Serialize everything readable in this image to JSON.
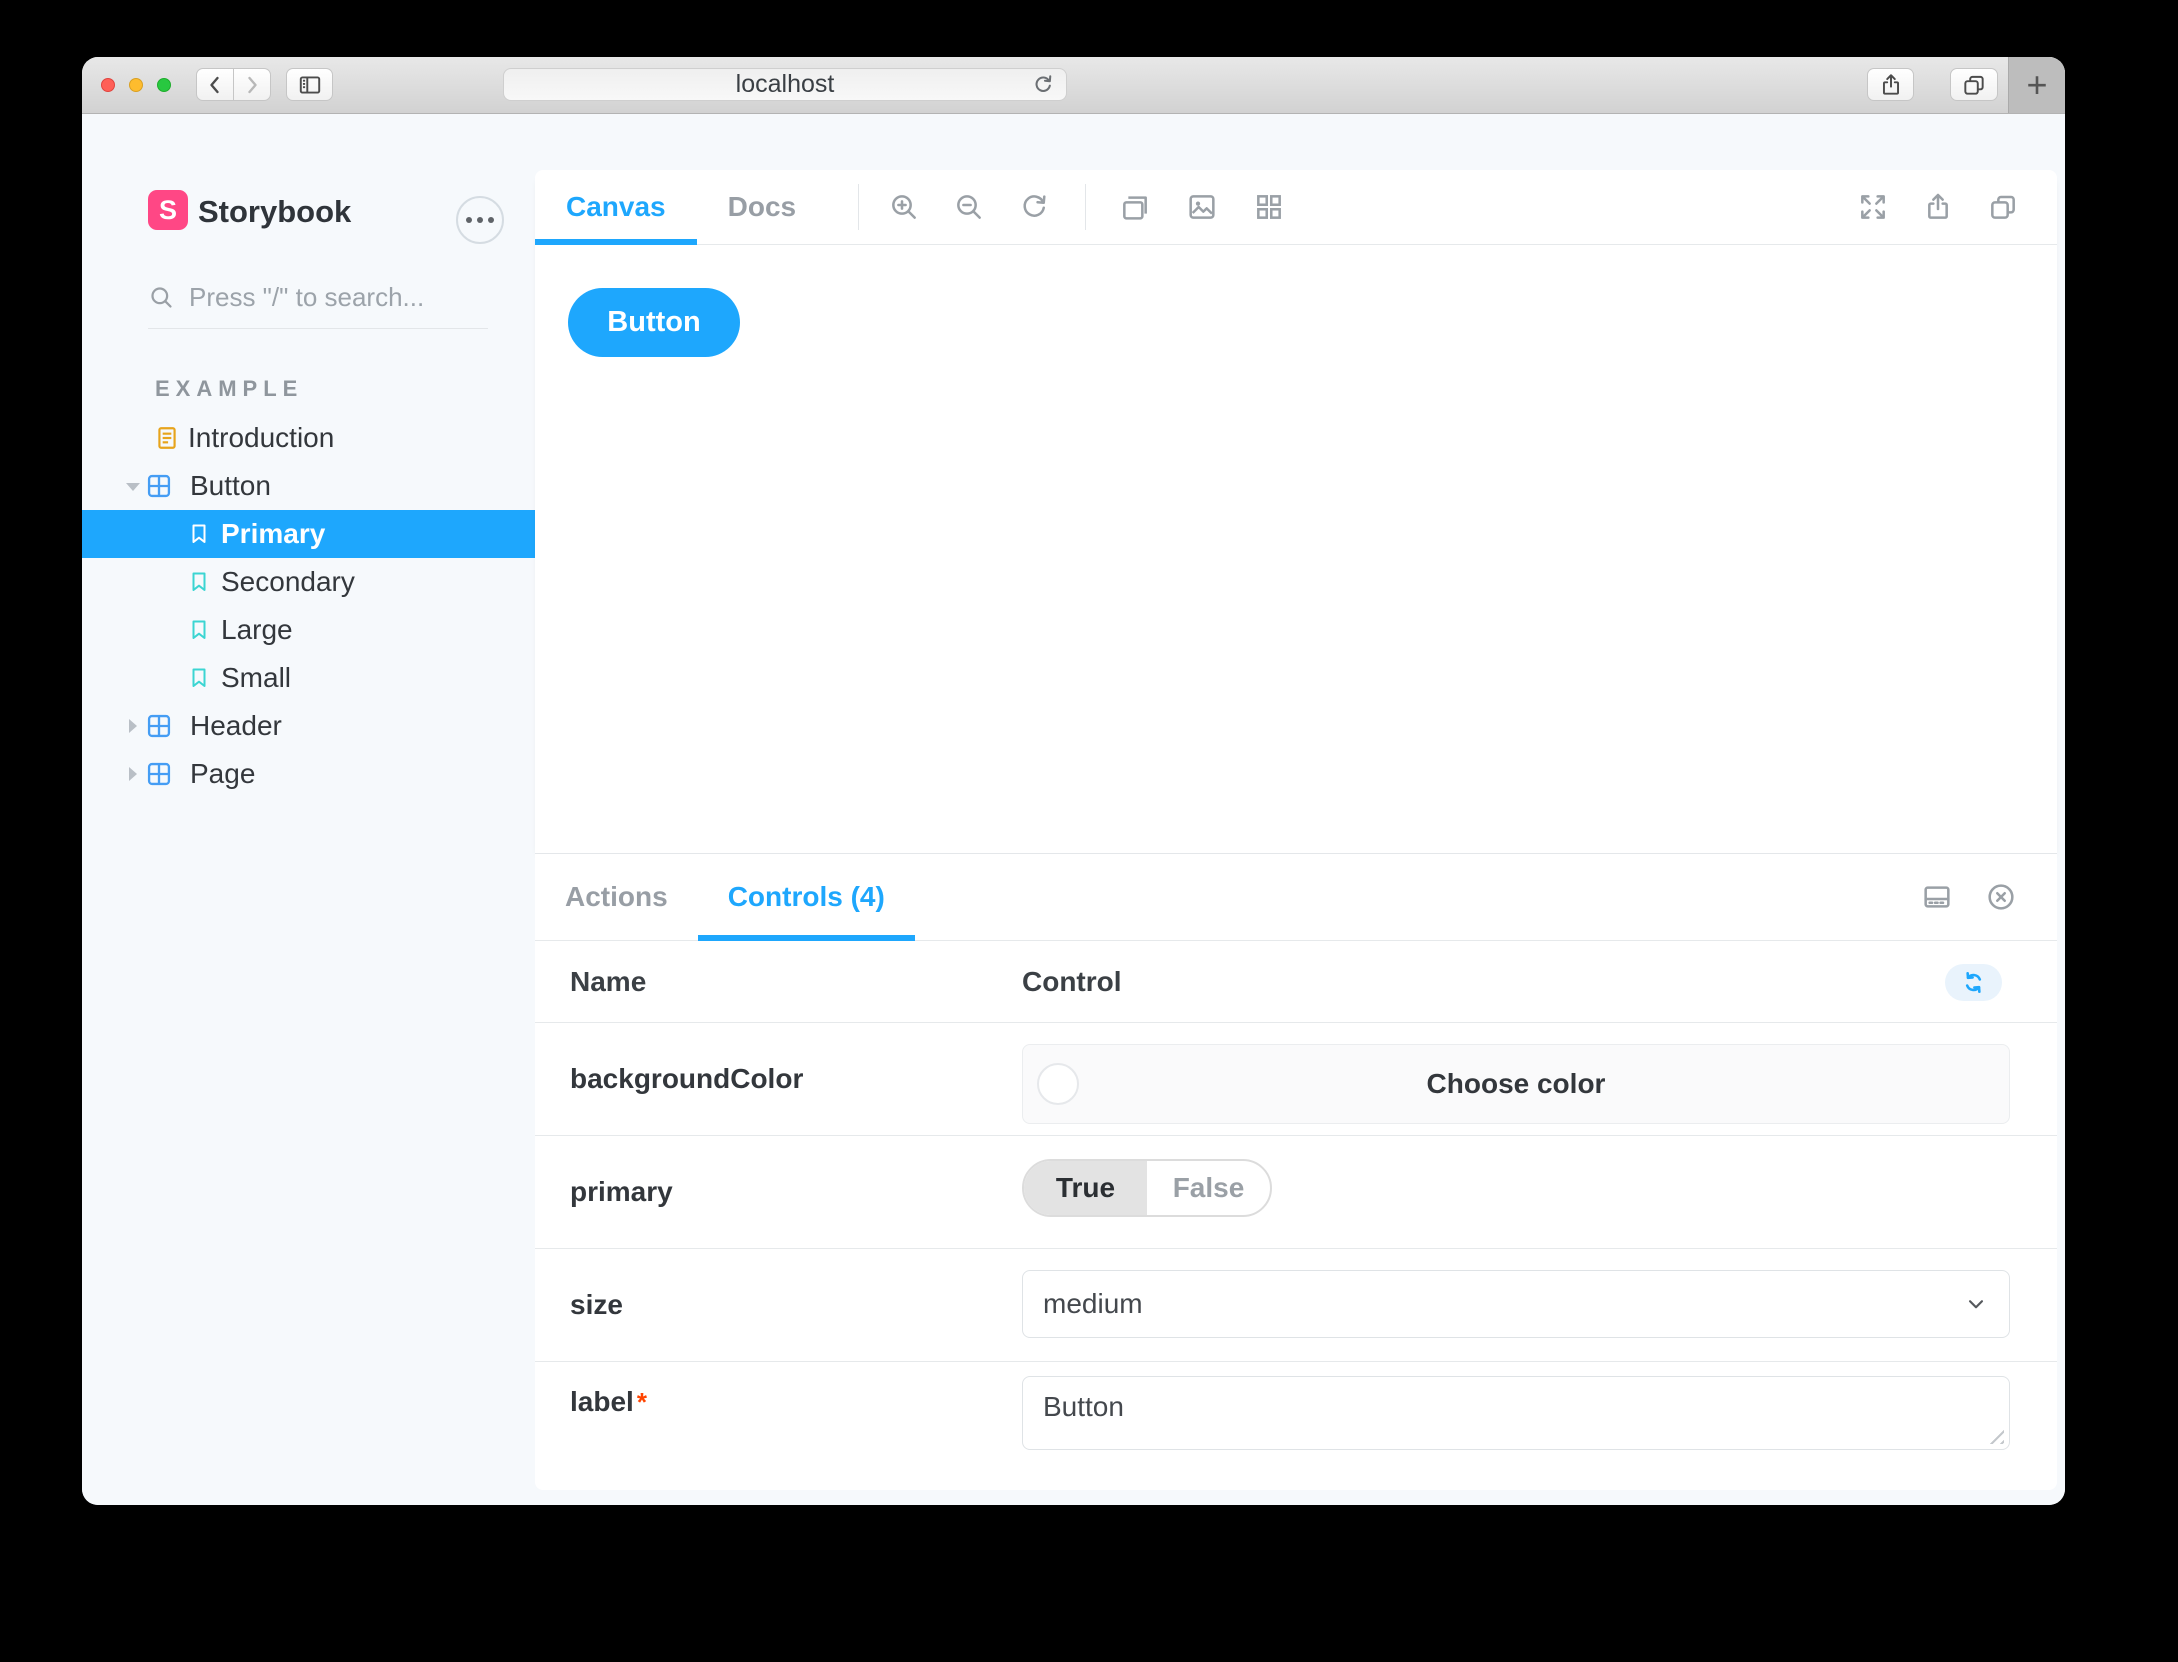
{
  "browser": {
    "url": "localhost",
    "new_tab_label": "+"
  },
  "sidebar": {
    "brand": "Storybook",
    "logo_letter": "S",
    "search_placeholder": "Press \"/\" to search...",
    "section_title": "EXAMPLE",
    "items": [
      {
        "label": "Introduction",
        "type": "doc"
      },
      {
        "label": "Button",
        "type": "component",
        "state": "expanded"
      },
      {
        "label": "Primary",
        "type": "story",
        "state": "selected"
      },
      {
        "label": "Secondary",
        "type": "story"
      },
      {
        "label": "Large",
        "type": "story"
      },
      {
        "label": "Small",
        "type": "story"
      },
      {
        "label": "Header",
        "type": "component",
        "state": "collapsed"
      },
      {
        "label": "Page",
        "type": "component",
        "state": "collapsed"
      }
    ]
  },
  "canvas": {
    "tabs": {
      "canvas": "Canvas",
      "docs": "Docs"
    },
    "preview_button": "Button"
  },
  "panel": {
    "tabs": {
      "actions": "Actions",
      "controls": "Controls (4)"
    },
    "header": {
      "name": "Name",
      "control": "Control"
    },
    "rows": {
      "backgroundColor": {
        "name": "backgroundColor",
        "control_label": "Choose color"
      },
      "primary": {
        "name": "primary",
        "true_label": "True",
        "false_label": "False",
        "selected": "True"
      },
      "size": {
        "name": "size",
        "value": "medium"
      },
      "label": {
        "name": "label",
        "required_mark": "*",
        "value": "Button"
      }
    }
  },
  "colors": {
    "accent": "#1EA7FD",
    "brand": "#FF4785",
    "story_icon": "#3BD5D2",
    "component_icon": "#459DF4",
    "doc_icon": "#E7A41C",
    "required": "#FF4400",
    "traffic_red": "#FF5F57",
    "traffic_yellow": "#FEBC2E",
    "traffic_green": "#28C840"
  }
}
